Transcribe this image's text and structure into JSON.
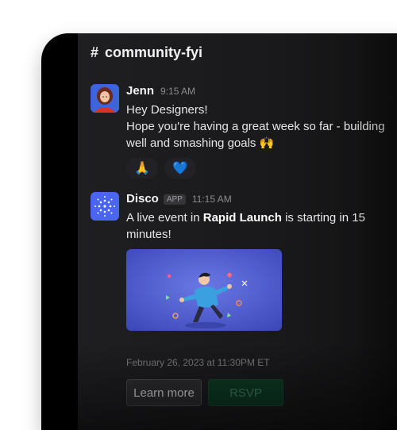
{
  "channel": {
    "hash": "#",
    "name": "community-fyi"
  },
  "messages": [
    {
      "sender": "Jenn",
      "time": "9:15 AM",
      "lines": [
        "Hey Designers!",
        "Hope you're having a great week so far - building",
        "well and smashing goals 🙌"
      ],
      "reactions": [
        {
          "emoji": "🙏",
          "icon": "folded-hands-icon"
        },
        {
          "emoji": "💙",
          "icon": "blue-heart-icon"
        }
      ]
    },
    {
      "sender": "Disco",
      "badge": "APP",
      "time": "11:15 AM",
      "text_part1": "A live event in ",
      "text_bold": "Rapid Launch",
      "text_part2": " is starting in 15",
      "text_line2": "minutes!",
      "date": "February 26, 2023 at 11:30PM ET",
      "buttons": {
        "learn_more": "Learn more",
        "rsvp": "RSVP"
      }
    }
  ],
  "colors": {
    "background": "#1f1f22",
    "brand_disco": "#4a66f0",
    "rsvp_green": "#0d3a24",
    "event_image_blue": "#4f5fd0"
  }
}
